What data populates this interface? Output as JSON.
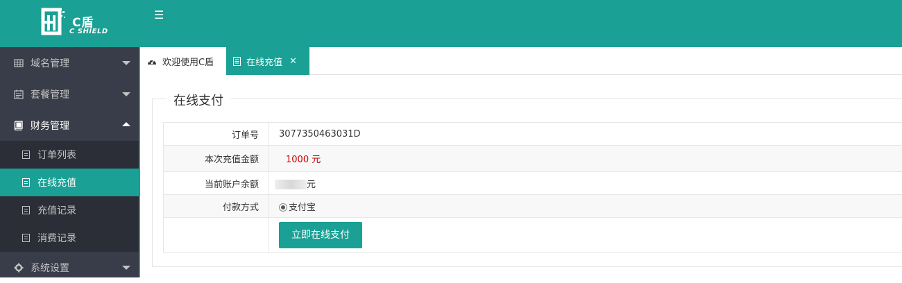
{
  "brand": {
    "title": "C盾",
    "subtitle": "C SHIELD",
    "color": "#1aa094"
  },
  "header": {
    "menu_icon": "hamburger-icon"
  },
  "sidebar": {
    "items": [
      {
        "label": "域名管理",
        "icon": "table-icon"
      },
      {
        "label": "套餐管理",
        "icon": "calendar-icon"
      },
      {
        "label": "财务管理",
        "icon": "book-icon",
        "expanded": true,
        "children": [
          {
            "label": "订单列表"
          },
          {
            "label": "在线充值",
            "active": true
          },
          {
            "label": "充值记录"
          },
          {
            "label": "消费记录"
          }
        ]
      },
      {
        "label": "系统设置",
        "icon": "gear-icon"
      }
    ]
  },
  "tabs": [
    {
      "label": "欢迎使用C盾",
      "icon": "dashboard-icon"
    },
    {
      "label": "在线充值",
      "icon": "document-icon",
      "active": true,
      "close": "✕"
    }
  ],
  "main": {
    "legend": "在线支付",
    "order_label": "订单号",
    "order_value": "3077350463031D",
    "amount_label": "本次充值金额",
    "amount_value": "1000 元",
    "balance_label": "当前账户余额",
    "balance_unit": "元",
    "method_label": "付款方式",
    "method_option": "支付宝",
    "pay_button": "立即在线支付"
  }
}
